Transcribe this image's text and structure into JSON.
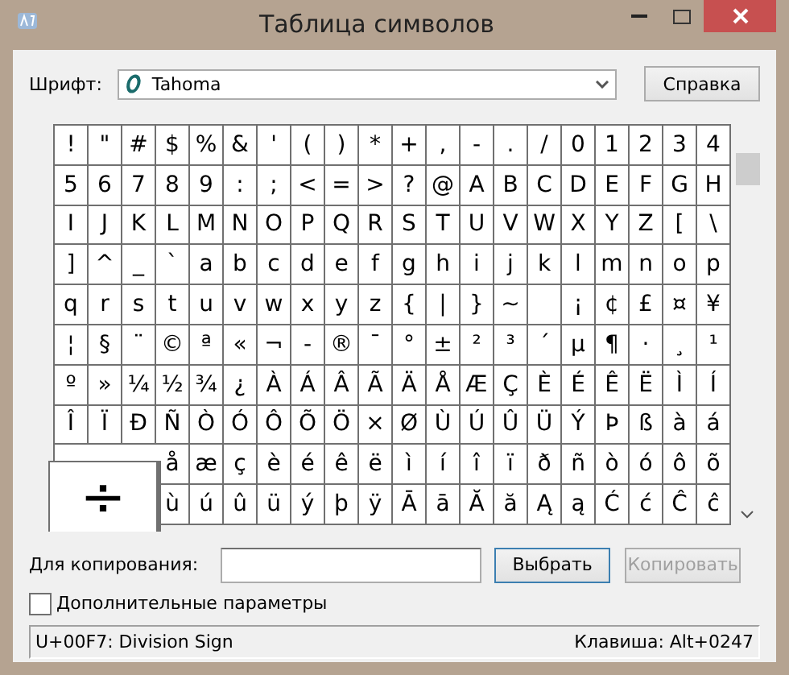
{
  "window": {
    "title": "Таблица символов"
  },
  "font": {
    "label": "Шрифт:",
    "value": "Tahoma"
  },
  "help_button": "Справка",
  "grid": {
    "rows": [
      [
        "!",
        "\"",
        "#",
        "$",
        "%",
        "&",
        "'",
        "(",
        ")",
        "*",
        "+",
        ",",
        "-",
        ".",
        "/",
        "0",
        "1",
        "2",
        "3",
        "4"
      ],
      [
        "5",
        "6",
        "7",
        "8",
        "9",
        ":",
        ";",
        "<",
        "=",
        ">",
        "?",
        "@",
        "A",
        "B",
        "C",
        "D",
        "E",
        "F",
        "G",
        "H"
      ],
      [
        "I",
        "J",
        "K",
        "L",
        "M",
        "N",
        "O",
        "P",
        "Q",
        "R",
        "S",
        "T",
        "U",
        "V",
        "W",
        "X",
        "Y",
        "Z",
        "[",
        "\\"
      ],
      [
        "]",
        "^",
        "_",
        "`",
        "a",
        "b",
        "c",
        "d",
        "e",
        "f",
        "g",
        "h",
        "i",
        "j",
        "k",
        "l",
        "m",
        "n",
        "o",
        "p"
      ],
      [
        "q",
        "r",
        "s",
        "t",
        "u",
        "v",
        "w",
        "x",
        "y",
        "z",
        "{",
        "|",
        "}",
        "~",
        null,
        "¡",
        "¢",
        "£",
        "¤",
        "¥"
      ],
      [
        "¦",
        "§",
        "¨",
        "©",
        "ª",
        "«",
        "¬",
        "-",
        "®",
        "¯",
        "°",
        "±",
        "²",
        "³",
        "´",
        "µ",
        "¶",
        "·",
        "¸",
        "¹"
      ],
      [
        "º",
        "»",
        "¼",
        "½",
        "¾",
        "¿",
        "À",
        "Á",
        "Â",
        "Ã",
        "Ä",
        "Å",
        "Æ",
        "Ç",
        "È",
        "É",
        "Ê",
        "Ë",
        "Ì",
        "Í"
      ],
      [
        "Î",
        "Ï",
        "Ð",
        "Ñ",
        "Ò",
        "Ó",
        "Ô",
        "Õ",
        "Ö",
        "×",
        "Ø",
        "Ù",
        "Ú",
        "Û",
        "Ü",
        "Ý",
        "Þ",
        "ß",
        "à",
        "á"
      ],
      [
        "å",
        "æ",
        "ç",
        "è",
        "é",
        "ê",
        "ë",
        "ì",
        "í",
        "î",
        "ï",
        "ð",
        "ñ",
        "ò",
        "ó",
        "ô",
        "õ"
      ],
      [
        "ù",
        "ú",
        "û",
        "ü",
        "ý",
        "þ",
        "ÿ",
        "Ā",
        "ā",
        "Ă",
        "ă",
        "Ą",
        "ą",
        "Ć",
        "ć",
        "Ĉ",
        "ĉ"
      ]
    ],
    "magnified": "÷"
  },
  "copy": {
    "label": "Для копирования:",
    "select_button": "Выбрать",
    "copy_button": {
      "label": "Копировать",
      "disabled": true
    }
  },
  "advanced": {
    "label": "Дополнительные параметры",
    "checked": false
  },
  "status_bar": {
    "character": "U+00F7: Division Sign",
    "keystroke": "Клавиша: Alt+0247"
  }
}
